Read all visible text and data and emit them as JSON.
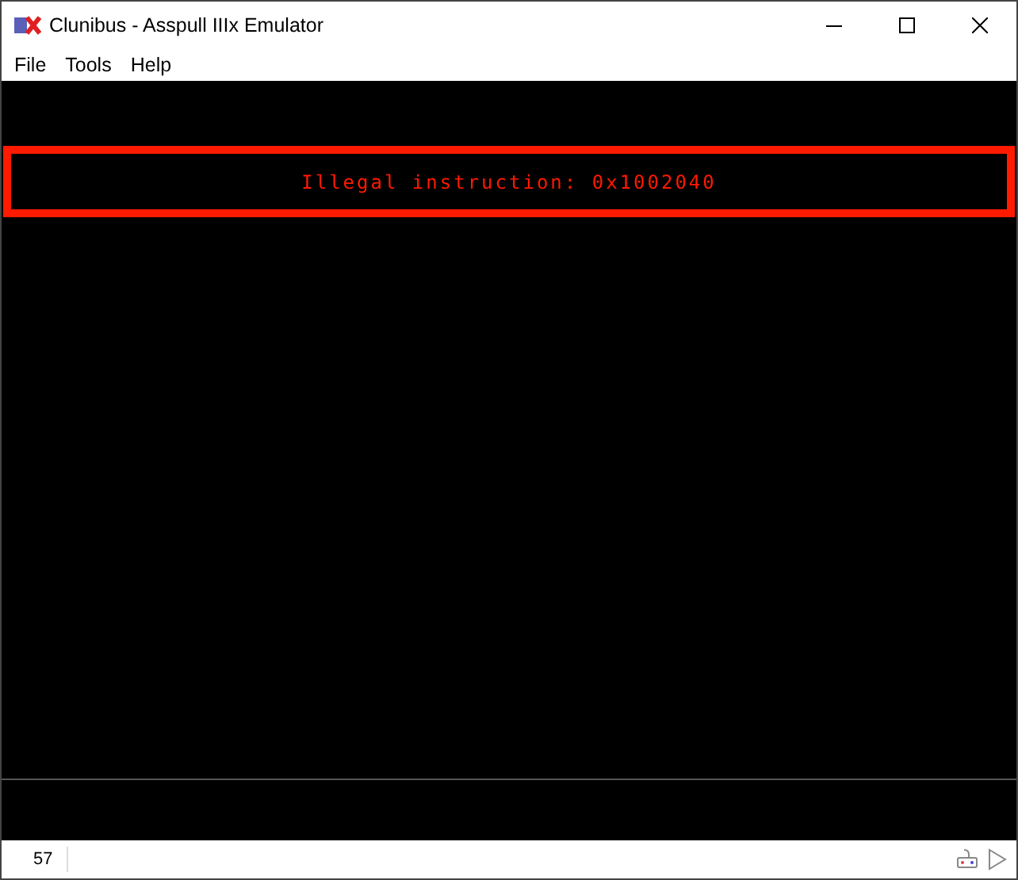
{
  "window": {
    "title": "Clunibus - Asspull IIIx Emulator"
  },
  "menu": [
    "File",
    "Tools",
    "Help"
  ],
  "screen": {
    "message": "Illegal instruction: 0x1002040"
  },
  "status_bar": {
    "fps": "57"
  }
}
